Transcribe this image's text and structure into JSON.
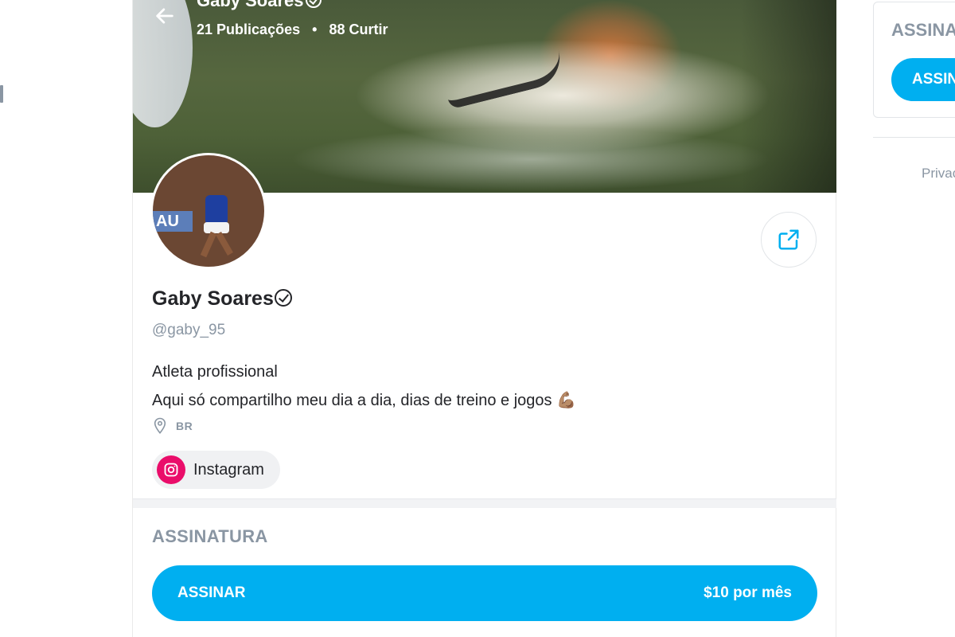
{
  "cover": {
    "name": "Gaby Soares",
    "posts_count": "21",
    "posts_label": "Publicações",
    "likes_count": "88",
    "likes_label": "Curtir",
    "separator": "•"
  },
  "profile": {
    "name": "Gaby Soares",
    "handle": "@gaby_95",
    "bio_line1": "Atleta profissional",
    "bio_line2": "Aqui só compartilho meu dia a dia, dias de treino e jogos",
    "bio_emoji": "💪🏽",
    "location": "BR",
    "social_label": "Instagram",
    "avatar_banner_text": "AU"
  },
  "subscription": {
    "title": "ASSINATURA",
    "button_label": "ASSINAR",
    "price": "$10 por mês"
  },
  "sidebar_right": {
    "title": "ASSINATURA",
    "button_label": "ASSINAR",
    "footer_link": "Privacidade"
  },
  "colors": {
    "accent": "#00aff0",
    "instagram": "#ea0d6a",
    "muted": "#8a96a3"
  },
  "icons": {
    "back": "arrow-left-icon",
    "share": "share-icon",
    "verified": "verified-badge-icon",
    "location": "map-pin-icon",
    "social": "instagram-icon"
  }
}
